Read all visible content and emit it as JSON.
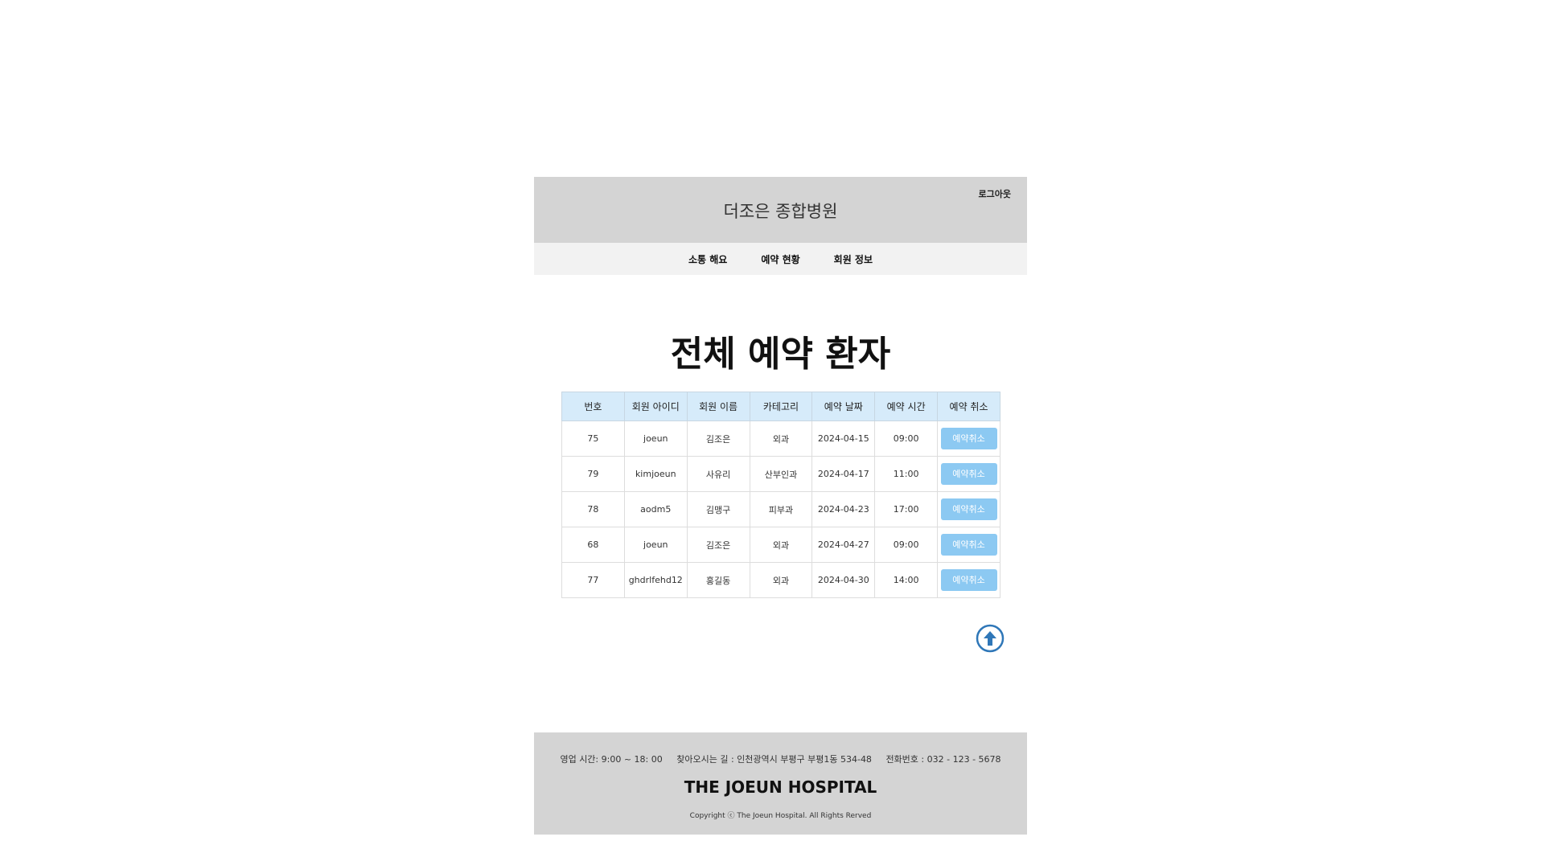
{
  "header": {
    "title": "더조은 종합병원",
    "logout_label": "로그아웃"
  },
  "nav": {
    "items": [
      {
        "label": "소통 해요"
      },
      {
        "label": "예약 현황"
      },
      {
        "label": "회원 정보"
      }
    ]
  },
  "main": {
    "heading": "전체 예약 환자",
    "table": {
      "headers": [
        "번호",
        "회원 아이디",
        "회원 이름",
        "카테고리",
        "예약 날짜",
        "예약 시간",
        "예약 취소"
      ],
      "rows": [
        {
          "no": "75",
          "id": "joeun",
          "name": "김조은",
          "category": "외과",
          "date": "2024-04-15",
          "time": "09:00",
          "cancel": "예약취소"
        },
        {
          "no": "79",
          "id": "kimjoeun",
          "name": "사유리",
          "category": "산부인과",
          "date": "2024-04-17",
          "time": "11:00",
          "cancel": "예약취소"
        },
        {
          "no": "78",
          "id": "aodm5",
          "name": "김맹구",
          "category": "피부과",
          "date": "2024-04-23",
          "time": "17:00",
          "cancel": "예약취소"
        },
        {
          "no": "68",
          "id": "joeun",
          "name": "김조은",
          "category": "외과",
          "date": "2024-04-27",
          "time": "09:00",
          "cancel": "예약취소"
        },
        {
          "no": "77",
          "id": "ghdrlfehd12",
          "name": "홍길동",
          "category": "외과",
          "date": "2024-04-30",
          "time": "14:00",
          "cancel": "예약취소"
        }
      ]
    },
    "top_button_icon": "arrow-up-circle-icon"
  },
  "footer": {
    "hours": "영업 시간: 9:00 ~ 18: 00",
    "address": "찾아오시는 길 : 인천광역시 부평구 부평1동 534-48",
    "phone": "전화번호 : 032 - 123 - 5678",
    "brand": "THE JOEUN HOSPITAL",
    "copyright": "Copyright ⓒ The Joeun Hospital. All Rights Rerved"
  },
  "colors": {
    "header_bg": "#d4d4d4",
    "nav_bg": "#f2f2f2",
    "table_header_bg": "#d6ebfa",
    "cancel_button_bg": "#8cc9f2",
    "top_button_color": "#2f77b8"
  }
}
